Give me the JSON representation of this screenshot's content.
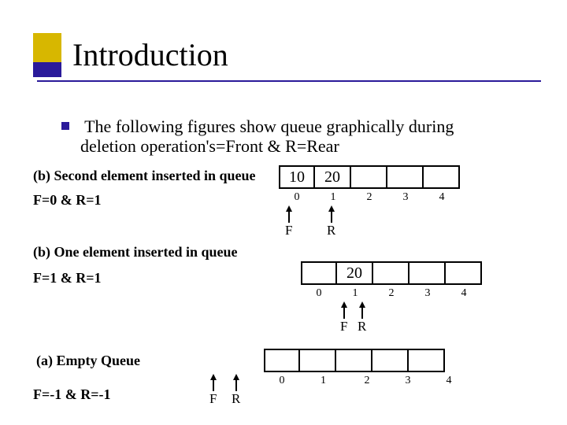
{
  "title": "Introduction",
  "bullet": "The following figures show queue graphically during",
  "bullet_cont": "deletion operation's=Front & R=Rear",
  "q1": {
    "caption": "(b) Second element inserted in queue",
    "fr": "F=0 & R=1",
    "cells": [
      "10",
      "20",
      "",
      "",
      ""
    ],
    "indices": [
      "0",
      "1",
      "2",
      "3",
      "4"
    ],
    "F": "F",
    "R": "R"
  },
  "q2": {
    "caption": "(b) One element inserted in queue",
    "fr": "F=1 & R=1",
    "cells": [
      "",
      "20",
      "",
      "",
      ""
    ],
    "indices": [
      "0",
      "1",
      "2",
      "3",
      "4"
    ],
    "F": "F",
    "R": "R"
  },
  "q3": {
    "caption": "(a) Empty Queue",
    "fr": "F=-1 & R=-1",
    "cells": [
      "",
      "",
      "",
      "",
      ""
    ],
    "indices": [
      "0",
      "1",
      "2",
      "3",
      "4"
    ],
    "F": "F",
    "R": "R"
  }
}
